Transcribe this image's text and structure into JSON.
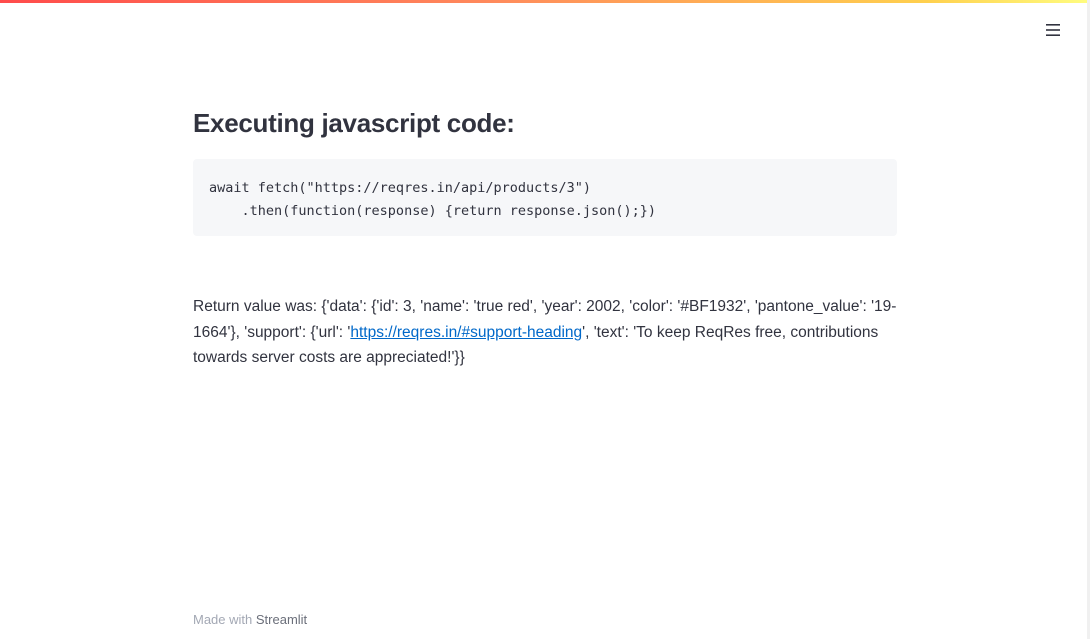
{
  "header": {
    "menu_icon": "hamburger-menu-icon",
    "gradient_colors": [
      "#ff4b4b",
      "#ff8a5c",
      "#ffd04e",
      "#fffd80"
    ]
  },
  "main": {
    "title": "Executing javascript code:",
    "code": {
      "line1": "await fetch(\"https://reqres.in/api/products/3\")",
      "line2": "    .then(function(response) {return response.json();})"
    },
    "result": {
      "before_link": "Return value was: {'data': {'id': 3, 'name': 'true red', 'year': 2002, 'color': '#BF1932', 'pantone_value': '19-1664'}, 'support': {'url': '",
      "link_text": "https://reqres.in/#support-heading",
      "link_href": "https://reqres.in/#support-heading",
      "after_link": "', 'text': 'To keep ReqRes free, contributions towards server costs are appreciated!'}}"
    }
  },
  "footer": {
    "prefix": "Made with ",
    "brand": "Streamlit"
  },
  "colors": {
    "text": "#31333f",
    "link": "#0068c9",
    "code_bg": "#f6f7f9",
    "footer_text": "#a3a8b4"
  }
}
